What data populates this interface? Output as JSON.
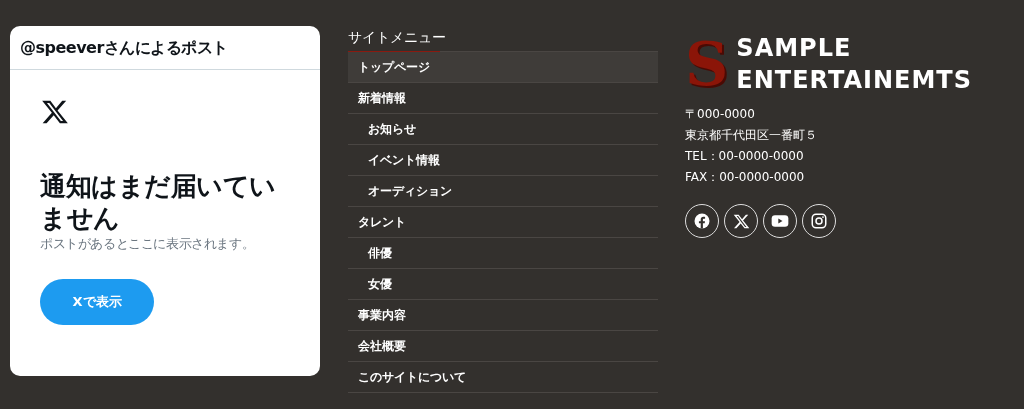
{
  "post_card": {
    "title": "@speeverさんによるポスト",
    "heading": "通知はまだ届いていません",
    "message": "ポストがあるとここに表示されます。",
    "button": "Xで表示"
  },
  "site_menu": {
    "title": "サイトメニュー",
    "items": [
      {
        "label": "トップページ",
        "selected": true
      },
      {
        "label": "新着情報",
        "selected": false,
        "children": [
          {
            "label": "お知らせ",
            "selected": false
          },
          {
            "label": "イベント情報",
            "selected": false
          },
          {
            "label": "オーディション",
            "selected": false
          }
        ]
      },
      {
        "label": "タレント",
        "selected": false,
        "children": [
          {
            "label": "俳優",
            "selected": false
          },
          {
            "label": "女優",
            "selected": false
          }
        ]
      },
      {
        "label": "事業内容",
        "selected": false
      },
      {
        "label": "会社概要",
        "selected": false
      },
      {
        "label": "このサイトについて",
        "selected": false
      }
    ]
  },
  "company": {
    "logo_mark": "S",
    "logo_lines": [
      "SAMPLE",
      "ENTERTAINEMTS"
    ],
    "address": [
      "〒000-0000",
      "東京都千代田区一番町５",
      "TEL：00-0000-0000",
      "FAX：00-0000-0000"
    ],
    "social": [
      {
        "kind": "facebook"
      },
      {
        "kind": "x"
      },
      {
        "kind": "youtube"
      },
      {
        "kind": "instagram"
      }
    ]
  }
}
